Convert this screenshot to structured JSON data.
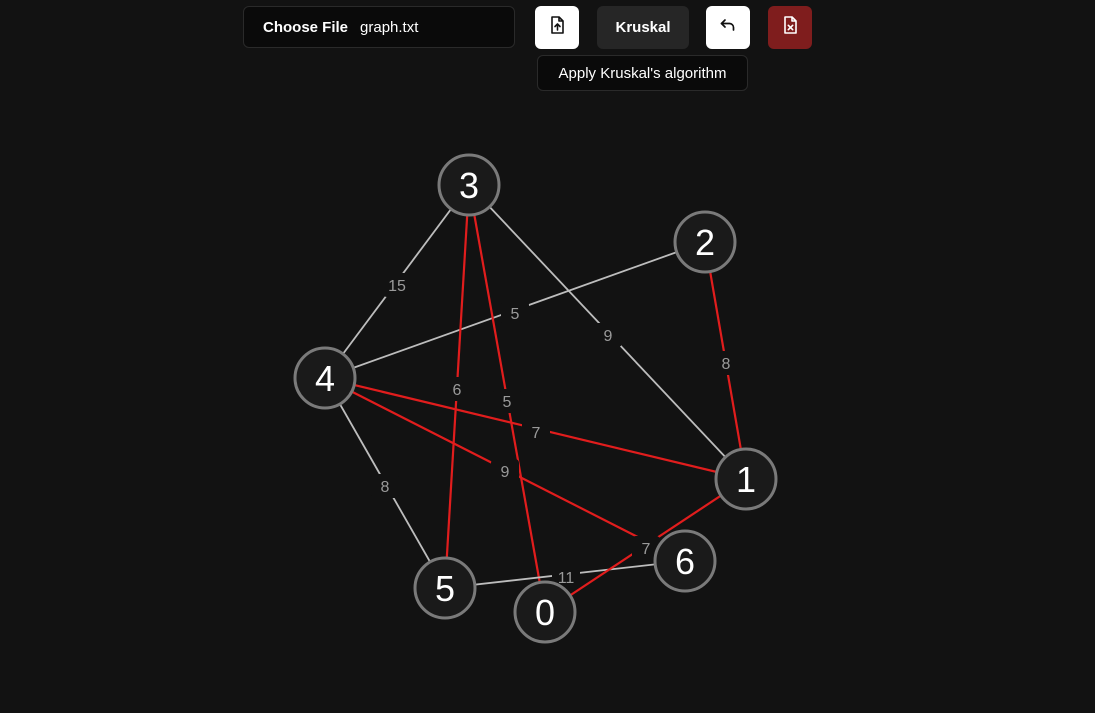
{
  "toolbar": {
    "choose_file_label": "Choose File",
    "file_name": "graph.txt",
    "upload_icon": "file-upload-icon",
    "kruskal_label": "Kruskal",
    "undo_icon": "undo-icon",
    "clear_icon": "file-remove-icon",
    "tooltip": "Apply Kruskal's algorithm"
  },
  "colors": {
    "background": "#121212",
    "node_fill": "#1a1a1a",
    "node_stroke": "#7a7a7a",
    "edge_default": "#bdbdbd",
    "edge_mst": "#e11d1d",
    "edge_label": "#9a9a9a",
    "clear_button": "#7f1d1d"
  },
  "graph": {
    "nodes": [
      {
        "id": "0",
        "label": "0"
      },
      {
        "id": "1",
        "label": "1"
      },
      {
        "id": "2",
        "label": "2"
      },
      {
        "id": "3",
        "label": "3"
      },
      {
        "id": "4",
        "label": "4"
      },
      {
        "id": "5",
        "label": "5"
      },
      {
        "id": "6",
        "label": "6"
      }
    ],
    "edges": [
      {
        "from": "3",
        "to": "4",
        "weight": "15",
        "mst": false
      },
      {
        "from": "2",
        "to": "4",
        "weight": "5",
        "mst": false
      },
      {
        "from": "3",
        "to": "1",
        "weight": "9",
        "mst": false
      },
      {
        "from": "2",
        "to": "1",
        "weight": "8",
        "mst": true
      },
      {
        "from": "3",
        "to": "5",
        "weight": "6",
        "mst": true
      },
      {
        "from": "3",
        "to": "0",
        "weight": "5",
        "mst": true
      },
      {
        "from": "4",
        "to": "1",
        "weight": "7",
        "mst": true
      },
      {
        "from": "4",
        "to": "6",
        "weight": "9",
        "mst": true
      },
      {
        "from": "4",
        "to": "5",
        "weight": "8",
        "mst": false
      },
      {
        "from": "5",
        "to": "6",
        "weight": "11",
        "mst": false
      },
      {
        "from": "1",
        "to": "0",
        "weight": "7",
        "mst": true
      }
    ]
  }
}
